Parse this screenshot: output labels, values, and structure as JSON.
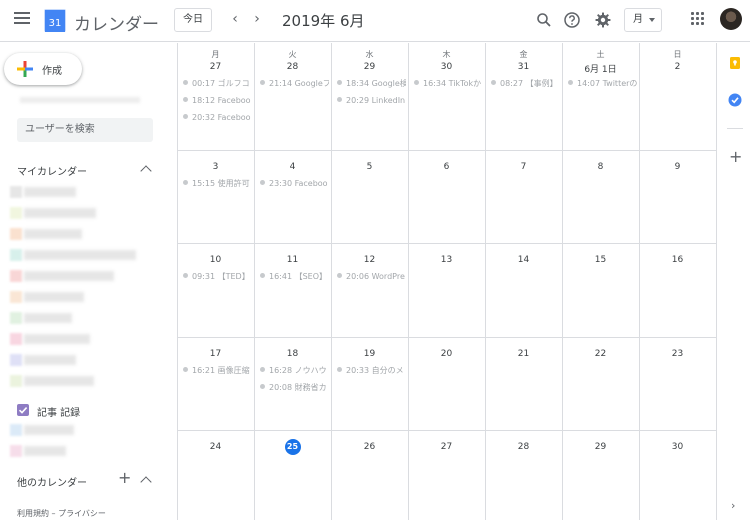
{
  "header": {
    "logo_day": "31",
    "app_title": "カレンダー",
    "today_label": "今日",
    "prev_arrow": "‹",
    "next_arrow": "›",
    "current_period": "2019年 6月",
    "view_label": "月"
  },
  "sidebar": {
    "create_label": "作成",
    "search_users_placeholder": "ユーザーを検索",
    "my_calendars_title": "マイカレンダー",
    "visible_calendar_label": "記事 記録",
    "other_calendars_title": "他のカレンダー",
    "footer_links": "利用規約 – プライバシー",
    "calendar_colors": [
      "#d3d3d3",
      "#e6efc6",
      "#f7c9a8",
      "#b8e4dc",
      "#f4b6b6",
      "#f6d3b4",
      "#c9e6c9",
      "#f3b5c9",
      "#c5c8ef",
      "#dbeac4",
      "#bfdaf2",
      "#f0c3d9",
      "#e3cde8"
    ],
    "check_color": "#8e7cc3"
  },
  "month": {
    "weekdays": [
      "月",
      "火",
      "水",
      "木",
      "金",
      "土",
      "日"
    ],
    "weeks": [
      [
        {
          "label": "27",
          "events": [
            "00:17 ゴルフコ",
            "18:12 Faceboo",
            "20:32 Faceboo"
          ]
        },
        {
          "label": "28",
          "events": [
            "21:14 Googleフ"
          ]
        },
        {
          "label": "29",
          "events": [
            "18:34 Google検",
            "20:29 LinkedIn"
          ]
        },
        {
          "label": "30",
          "events": [
            "16:34 TikTokか"
          ]
        },
        {
          "label": "31",
          "events": [
            "08:27 【事例】"
          ]
        },
        {
          "label": "6月 1日",
          "events": [
            "14:07 Twitterの"
          ]
        },
        {
          "label": "2",
          "events": []
        }
      ],
      [
        {
          "label": "3",
          "events": [
            "15:15 使用許可"
          ]
        },
        {
          "label": "4",
          "events": [
            "23:30 Faceboo"
          ]
        },
        {
          "label": "5",
          "events": []
        },
        {
          "label": "6",
          "events": []
        },
        {
          "label": "7",
          "events": []
        },
        {
          "label": "8",
          "events": []
        },
        {
          "label": "9",
          "events": []
        }
      ],
      [
        {
          "label": "10",
          "events": [
            "09:31 【TED】"
          ]
        },
        {
          "label": "11",
          "events": [
            "16:41 【SEO】"
          ]
        },
        {
          "label": "12",
          "events": [
            "20:06 WordPre"
          ]
        },
        {
          "label": "13",
          "events": []
        },
        {
          "label": "14",
          "events": []
        },
        {
          "label": "15",
          "events": []
        },
        {
          "label": "16",
          "events": []
        }
      ],
      [
        {
          "label": "17",
          "events": [
            "16:21 画像圧縮"
          ]
        },
        {
          "label": "18",
          "events": [
            "16:28 ノウハウ",
            "20:08 財務省カ"
          ]
        },
        {
          "label": "19",
          "events": [
            "20:33 自分のメ"
          ]
        },
        {
          "label": "20",
          "events": []
        },
        {
          "label": "21",
          "events": []
        },
        {
          "label": "22",
          "events": []
        },
        {
          "label": "23",
          "events": []
        }
      ],
      [
        {
          "label": "24",
          "events": []
        },
        {
          "label": "25",
          "events": [],
          "today": true
        },
        {
          "label": "26",
          "events": []
        },
        {
          "label": "27",
          "events": []
        },
        {
          "label": "28",
          "events": []
        },
        {
          "label": "29",
          "events": []
        },
        {
          "label": "30",
          "events": []
        }
      ]
    ]
  },
  "colors": {
    "accent_blue": "#1a73e8",
    "keep_yellow": "#fbbc04",
    "tasks_blue": "#4285f4"
  },
  "icons": [
    "menu-icon",
    "search-icon",
    "help-icon",
    "settings-icon",
    "apps-icon",
    "keep-icon",
    "tasks-icon",
    "add-icon",
    "chevron-right-icon"
  ]
}
